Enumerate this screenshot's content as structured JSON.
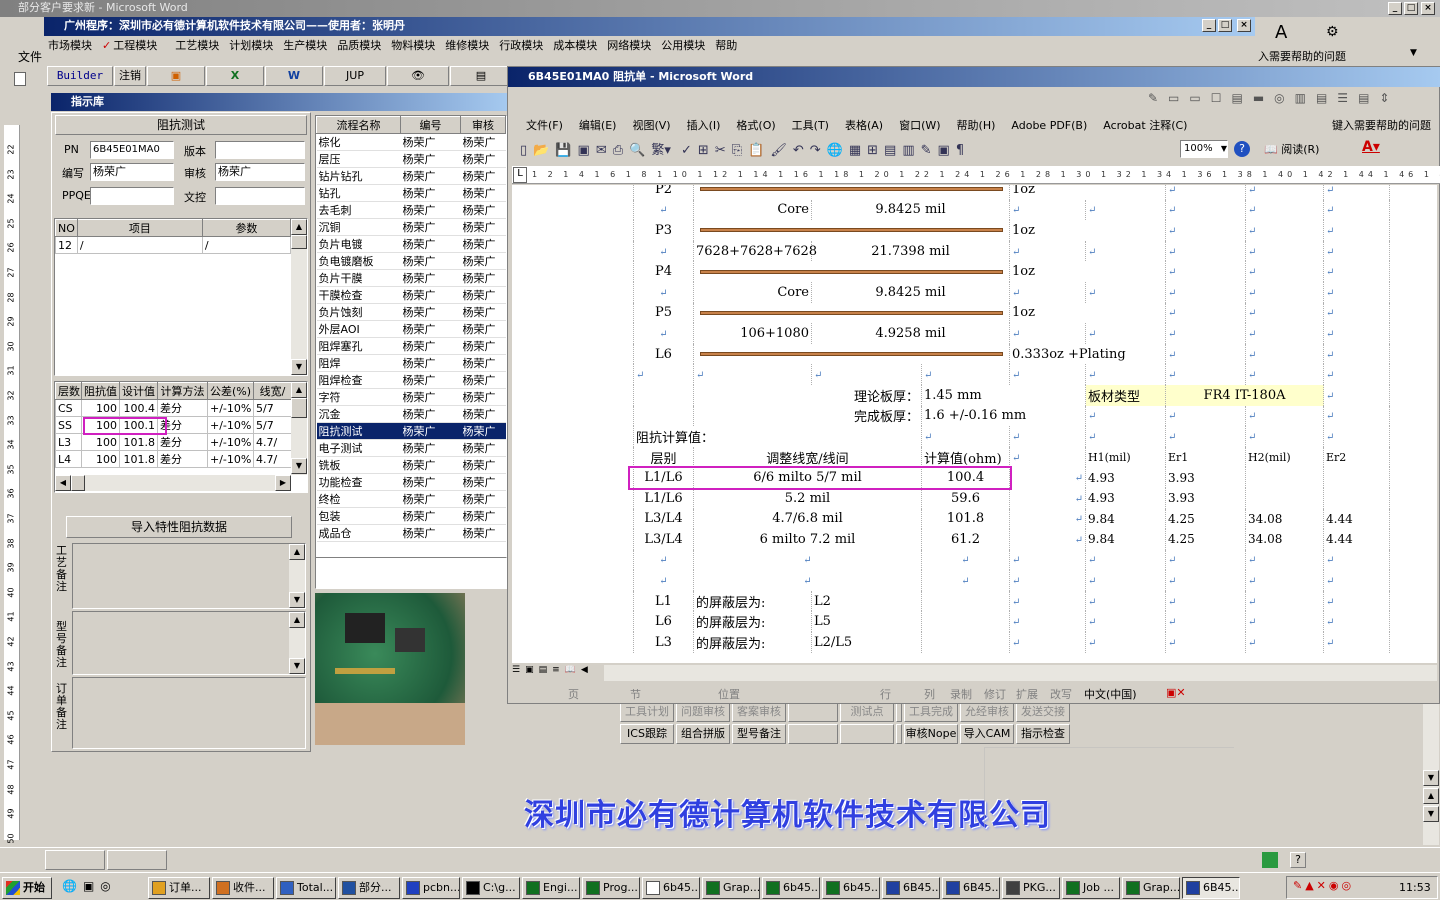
{
  "outer_title": "部分客户要求新 - Microsoft Word",
  "outer_right_text": "入需要帮助的问题",
  "app": {
    "title": "广州程序：深圳市必有德计算机软件技术有限公司——使用者：张明丹",
    "menu": [
      "市场模块",
      "工程模块",
      "工艺模块",
      "计划模块",
      "生产模块",
      "品质模块",
      "物料模块",
      "维修模块",
      "行政模块",
      "成本模块",
      "网络模块",
      "公用模块",
      "帮助"
    ],
    "left_menu": "文件",
    "toolbar": [
      "Builder",
      "注销",
      "JUP"
    ],
    "panel_title": "指示库",
    "section_title": "阻抗测试",
    "fields": {
      "pn_label": "PN",
      "pn": "6B45E01MA0",
      "ver_label": "版本",
      "ver": "",
      "author_label": "编写",
      "author": "杨荣广",
      "review_label": "审核",
      "review": "杨荣广",
      "pe_label": "PPQE",
      "pe": "",
      "wk_label": "文控",
      "wk": ""
    },
    "item_cols": [
      "NO",
      "项目",
      "参数"
    ],
    "item_rows": [
      [
        "12",
        "/",
        "/"
      ]
    ],
    "imp_cols": [
      "层数",
      "阻抗值",
      "设计值",
      "计算方法",
      "公差(%)",
      "线宽/"
    ],
    "imp_rows": [
      [
        "CS",
        "100",
        "100.4",
        "差分",
        "+/-10%",
        "5/7"
      ],
      [
        "SS",
        "100",
        "100.1",
        "差分",
        "+/-10%",
        "5/7"
      ],
      [
        "L3",
        "100",
        "101.8",
        "差分",
        "+/-10%",
        "4.7/"
      ],
      [
        "L4",
        "100",
        "101.8",
        "差分",
        "+/-10%",
        "4.7/"
      ]
    ],
    "import_btn": "导入特性阻抗数据",
    "notes": [
      "工艺备注",
      "型号备注",
      "订单备注"
    ],
    "flow_cols": [
      "流程名称",
      "编号",
      "审核"
    ],
    "flow": [
      "棕化",
      "层压",
      "钻片钻孔",
      "钻孔",
      "去毛刺",
      "沉铜",
      "负片电镀",
      "负电镀磨板",
      "负片干膜",
      "干膜检查",
      "负片蚀刻",
      "外层AOI",
      "阻焊塞孔",
      "阻焊",
      "阻焊检查",
      "字符",
      "沉金",
      "阻抗测试",
      "电子测试",
      "铣板",
      "功能检查",
      "终检",
      "包装",
      "成品仓"
    ],
    "flow_person": "杨荣广",
    "flow_sel": "阻抗测试",
    "bottom_tabs": [
      [
        "工具计划",
        "问题审核",
        "客案审核",
        "",
        "测试点",
        "",
        "工具完成",
        "允经审核",
        "发送交接"
      ],
      [
        "ICS跟踪",
        "组合拼版",
        "型号备注",
        "",
        "",
        "",
        "审核Nope",
        "导入CAM",
        "指示检查"
      ]
    ],
    "company": "深圳市必有德计算机软件技术有限公司"
  },
  "word": {
    "title": "6B45E01MA0 阻抗单 - Microsoft Word",
    "menu": [
      "文件(F)",
      "编辑(E)",
      "视图(V)",
      "插入(I)",
      "格式(O)",
      "工具(T)",
      "表格(A)",
      "窗口(W)",
      "帮助(H)",
      "Adobe PDF(B)",
      "Acrobat 注释(C)"
    ],
    "help_box": "键入需要帮助的问题",
    "zoom": "100%",
    "read_btn": "阅读(R)",
    "ruler": "1 2 1 4 1 6 1 8 1 10 1 12 1 14 1 16 1 18 1 20 1 22 1 24 1 26 1 28 1 30 1 32 1 34 1 36 1 38 1 40 1 42 1 44 1 46 1 48 1 50 1 52 1 54 1 56",
    "doc": {
      "stack": [
        {
          "layer": "P2",
          "copper": "1oz"
        },
        {
          "core": "Core",
          "val": "9.8425 mil"
        },
        {
          "layer": "P3",
          "copper": "1oz"
        },
        {
          "core": "7628+7628+7628",
          "val": "21.7398 mil"
        },
        {
          "layer": "P4",
          "copper": "1oz"
        },
        {
          "core": "Core",
          "val": "9.8425 mil"
        },
        {
          "layer": "P5",
          "copper": "1oz"
        },
        {
          "core": "106+1080",
          "val": "4.9258 mil"
        },
        {
          "layer": "L6",
          "copper": "0.333oz +Plating"
        }
      ],
      "thick_label": "理论板厚：",
      "thick": "1.45 mm",
      "mat_label": "板材类型",
      "mat": "FR4 IT-180A",
      "finish_label": "完成板厚：",
      "finish": "1.6 +/-0.16 mm",
      "calc_title": "阻抗计算值：",
      "hdr": [
        "层别",
        "调整线宽/线间",
        "计算值(ohm)",
        "H1(mil)",
        "Er1",
        "H2(mil)",
        "Er2"
      ],
      "rows": [
        [
          "L1/L6",
          "6/6 milto 5/7 mil",
          "100.4",
          "4.93",
          "3.93",
          "",
          ""
        ],
        [
          "L1/L6",
          "5.2 mil",
          "59.6",
          "4.93",
          "3.93",
          "",
          ""
        ],
        [
          "L3/L4",
          "4.7/6.8 mil",
          "101.8",
          "9.84",
          "4.25",
          "34.08",
          "4.44"
        ],
        [
          "L3/L4",
          "6 milto 7.2 mil",
          "61.2",
          "9.84",
          "4.25",
          "34.08",
          "4.44"
        ]
      ],
      "shield": [
        [
          "L1",
          "的屏蔽层为:",
          "L2"
        ],
        [
          "L6",
          "的屏蔽层为:",
          "L5"
        ],
        [
          "L3",
          "的屏蔽层为:",
          "L2/L5"
        ]
      ]
    },
    "status": [
      "页",
      "节",
      "位置",
      "行",
      "列",
      "录制",
      "修订",
      "扩展",
      "改写",
      "中文(中国)"
    ]
  },
  "taskbar": {
    "start": "开始",
    "items": [
      "订单...",
      "收件...",
      "Total...",
      "部分...",
      "pcbn...",
      "C:\\g...",
      "Engi...",
      "Prog...",
      "6b45...",
      "Grap...",
      "6b45...",
      "6b45...",
      "6B45...",
      "6B45...",
      "PKG...",
      "Job ...",
      "Grap...",
      "6B45..."
    ],
    "clock": "11:53"
  },
  "ruler_nums": [
    "22",
    "23",
    "24",
    "25",
    "26",
    "27",
    "28",
    "29",
    "30",
    "31",
    "32",
    "33",
    "34",
    "35",
    "36",
    "37",
    "38",
    "39",
    "40",
    "41",
    "42",
    "43",
    "44",
    "45",
    "46",
    "47",
    "48",
    "49",
    "50",
    "51"
  ]
}
